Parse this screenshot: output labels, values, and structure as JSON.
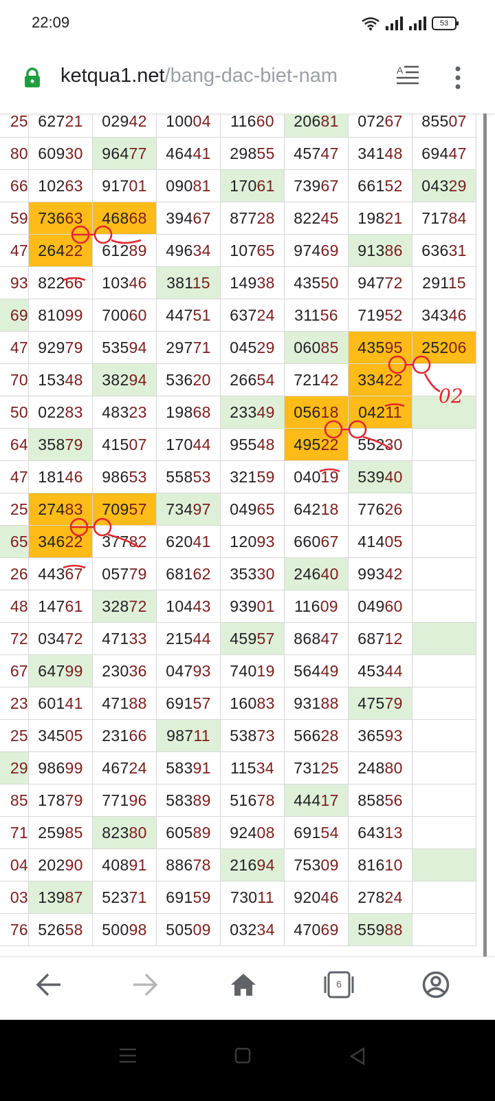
{
  "status_bar": {
    "time": "22:09",
    "battery": "53"
  },
  "browser": {
    "url_host": "ketqua1.net",
    "url_path": "/bang-dac-biet-nam",
    "tabs_count": "6"
  },
  "annotations": {
    "note": "02"
  },
  "table": {
    "rows": [
      {
        "cells": [
          {
            "v": "25"
          },
          {
            "v": "62721"
          },
          {
            "v": "02942"
          },
          {
            "v": "10004"
          },
          {
            "v": "11660"
          },
          {
            "v": "20681",
            "h": "g"
          },
          {
            "v": "07267"
          },
          {
            "v": "85507"
          }
        ]
      },
      {
        "cells": [
          {
            "v": "80"
          },
          {
            "v": "60930"
          },
          {
            "v": "96477",
            "h": "g"
          },
          {
            "v": "46441"
          },
          {
            "v": "29855"
          },
          {
            "v": "45747"
          },
          {
            "v": "34148"
          },
          {
            "v": "69447"
          }
        ]
      },
      {
        "cells": [
          {
            "v": "66"
          },
          {
            "v": "10263"
          },
          {
            "v": "91701"
          },
          {
            "v": "09081"
          },
          {
            "v": "17061",
            "h": "g"
          },
          {
            "v": "73967"
          },
          {
            "v": "66152"
          },
          {
            "v": "04329",
            "h": "g"
          }
        ]
      },
      {
        "cells": [
          {
            "v": "59"
          },
          {
            "v": "73663",
            "h": "o"
          },
          {
            "v": "46868",
            "h": "o"
          },
          {
            "v": "39467"
          },
          {
            "v": "87728"
          },
          {
            "v": "82245"
          },
          {
            "v": "19821"
          },
          {
            "v": "71784"
          }
        ]
      },
      {
        "cells": [
          {
            "v": "47"
          },
          {
            "v": "26422",
            "h": "o"
          },
          {
            "v": "61289"
          },
          {
            "v": "49634"
          },
          {
            "v": "10765"
          },
          {
            "v": "97469"
          },
          {
            "v": "91386",
            "h": "g"
          },
          {
            "v": "63631"
          }
        ]
      },
      {
        "cells": [
          {
            "v": "93"
          },
          {
            "v": "82266"
          },
          {
            "v": "10346"
          },
          {
            "v": "38115",
            "h": "g"
          },
          {
            "v": "14938"
          },
          {
            "v": "43550"
          },
          {
            "v": "94772"
          },
          {
            "v": "29115"
          }
        ]
      },
      {
        "cells": [
          {
            "v": "69",
            "h": "g"
          },
          {
            "v": "81099"
          },
          {
            "v": "70060"
          },
          {
            "v": "44751"
          },
          {
            "v": "63724"
          },
          {
            "v": "31156"
          },
          {
            "v": "71952"
          },
          {
            "v": "34346"
          }
        ]
      },
      {
        "cells": [
          {
            "v": "47"
          },
          {
            "v": "92979"
          },
          {
            "v": "53594"
          },
          {
            "v": "29771"
          },
          {
            "v": "04529"
          },
          {
            "v": "06085",
            "h": "g"
          },
          {
            "v": "43595",
            "h": "o"
          },
          {
            "v": "25206",
            "h": "o"
          }
        ]
      },
      {
        "cells": [
          {
            "v": "70"
          },
          {
            "v": "15348"
          },
          {
            "v": "38294",
            "h": "g"
          },
          {
            "v": "53620"
          },
          {
            "v": "26654"
          },
          {
            "v": "72142"
          },
          {
            "v": "33422",
            "h": "o"
          },
          {
            "v": ""
          }
        ]
      },
      {
        "cells": [
          {
            "v": "50"
          },
          {
            "v": "02283"
          },
          {
            "v": "48323"
          },
          {
            "v": "19868"
          },
          {
            "v": "23349",
            "h": "g"
          },
          {
            "v": "05618",
            "h": "o"
          },
          {
            "v": "04211",
            "h": "o"
          },
          {
            "v": "",
            "h": "g"
          }
        ]
      },
      {
        "cells": [
          {
            "v": "64"
          },
          {
            "v": "35879",
            "h": "g"
          },
          {
            "v": "41507"
          },
          {
            "v": "17044"
          },
          {
            "v": "95548"
          },
          {
            "v": "49522",
            "h": "o"
          },
          {
            "v": "55230"
          },
          {
            "v": ""
          }
        ]
      },
      {
        "cells": [
          {
            "v": "47"
          },
          {
            "v": "18146"
          },
          {
            "v": "98653"
          },
          {
            "v": "55853"
          },
          {
            "v": "32159"
          },
          {
            "v": "04019"
          },
          {
            "v": "53940",
            "h": "g"
          },
          {
            "v": ""
          }
        ]
      },
      {
        "cells": [
          {
            "v": "25"
          },
          {
            "v": "27483",
            "h": "o"
          },
          {
            "v": "70957",
            "h": "o"
          },
          {
            "v": "73497",
            "h": "g"
          },
          {
            "v": "04965"
          },
          {
            "v": "64218"
          },
          {
            "v": "77626"
          },
          {
            "v": ""
          }
        ]
      },
      {
        "cells": [
          {
            "v": "65",
            "h": "g"
          },
          {
            "v": "34622",
            "h": "o"
          },
          {
            "v": "37782"
          },
          {
            "v": "62041"
          },
          {
            "v": "12093"
          },
          {
            "v": "66067"
          },
          {
            "v": "41405"
          },
          {
            "v": ""
          }
        ]
      },
      {
        "cells": [
          {
            "v": "26"
          },
          {
            "v": "44367"
          },
          {
            "v": "05779"
          },
          {
            "v": "68162"
          },
          {
            "v": "35330"
          },
          {
            "v": "24640",
            "h": "g"
          },
          {
            "v": "99342"
          },
          {
            "v": ""
          }
        ]
      },
      {
        "cells": [
          {
            "v": "48"
          },
          {
            "v": "14761"
          },
          {
            "v": "32872",
            "h": "g"
          },
          {
            "v": "10443"
          },
          {
            "v": "93901"
          },
          {
            "v": "11609"
          },
          {
            "v": "04960"
          },
          {
            "v": ""
          }
        ]
      },
      {
        "cells": [
          {
            "v": "72"
          },
          {
            "v": "03472"
          },
          {
            "v": "47133"
          },
          {
            "v": "21544"
          },
          {
            "v": "45957",
            "h": "g"
          },
          {
            "v": "86847"
          },
          {
            "v": "68712"
          },
          {
            "v": "",
            "h": "g"
          }
        ]
      },
      {
        "cells": [
          {
            "v": "67"
          },
          {
            "v": "64799",
            "h": "g"
          },
          {
            "v": "23036"
          },
          {
            "v": "04793"
          },
          {
            "v": "74019"
          },
          {
            "v": "56449"
          },
          {
            "v": "45344"
          },
          {
            "v": ""
          }
        ]
      },
      {
        "cells": [
          {
            "v": "23"
          },
          {
            "v": "60141"
          },
          {
            "v": "47188"
          },
          {
            "v": "69157"
          },
          {
            "v": "16083"
          },
          {
            "v": "93188"
          },
          {
            "v": "47579",
            "h": "g"
          },
          {
            "v": ""
          }
        ]
      },
      {
        "cells": [
          {
            "v": "25"
          },
          {
            "v": "34505"
          },
          {
            "v": "23166"
          },
          {
            "v": "98711",
            "h": "g"
          },
          {
            "v": "53873"
          },
          {
            "v": "56628"
          },
          {
            "v": "36593"
          },
          {
            "v": ""
          }
        ]
      },
      {
        "cells": [
          {
            "v": "29",
            "h": "g"
          },
          {
            "v": "98699"
          },
          {
            "v": "46724"
          },
          {
            "v": "58391"
          },
          {
            "v": "11534"
          },
          {
            "v": "73125"
          },
          {
            "v": "24880"
          },
          {
            "v": ""
          }
        ]
      },
      {
        "cells": [
          {
            "v": "85"
          },
          {
            "v": "17879"
          },
          {
            "v": "77196"
          },
          {
            "v": "58389"
          },
          {
            "v": "51678"
          },
          {
            "v": "44417",
            "h": "g"
          },
          {
            "v": "85856"
          },
          {
            "v": ""
          }
        ]
      },
      {
        "cells": [
          {
            "v": "71"
          },
          {
            "v": "25985"
          },
          {
            "v": "82380",
            "h": "g"
          },
          {
            "v": "60589"
          },
          {
            "v": "92408"
          },
          {
            "v": "69154"
          },
          {
            "v": "64313"
          },
          {
            "v": ""
          }
        ]
      },
      {
        "cells": [
          {
            "v": "04"
          },
          {
            "v": "20290"
          },
          {
            "v": "40891"
          },
          {
            "v": "88678"
          },
          {
            "v": "21694",
            "h": "g"
          },
          {
            "v": "75309"
          },
          {
            "v": "81610"
          },
          {
            "v": "",
            "h": "g"
          }
        ]
      },
      {
        "cells": [
          {
            "v": "03"
          },
          {
            "v": "13987",
            "h": "g"
          },
          {
            "v": "52371"
          },
          {
            "v": "69159"
          },
          {
            "v": "73011"
          },
          {
            "v": "92046"
          },
          {
            "v": "27824"
          },
          {
            "v": ""
          }
        ]
      },
      {
        "cells": [
          {
            "v": "76"
          },
          {
            "v": "52658"
          },
          {
            "v": "50098"
          },
          {
            "v": "50509"
          },
          {
            "v": "03234"
          },
          {
            "v": "47069"
          },
          {
            "v": "55988",
            "h": "g"
          },
          {
            "v": ""
          }
        ]
      }
    ]
  }
}
